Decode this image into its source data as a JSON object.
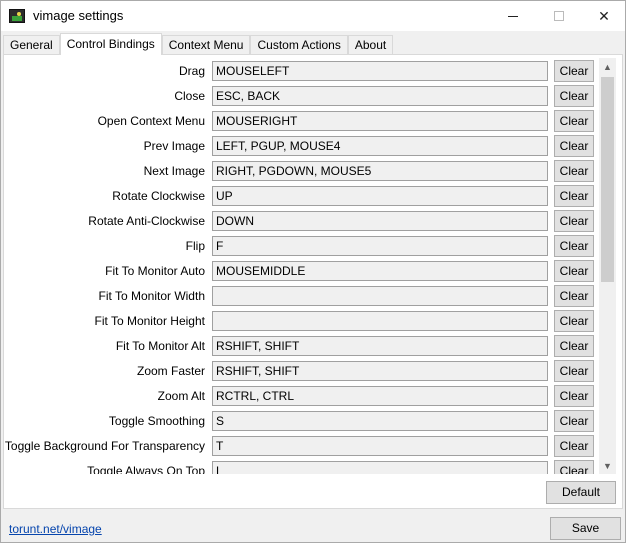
{
  "window": {
    "title": "vimage settings",
    "icon": "vimage-app-icon",
    "controls": {
      "minimize": "minimize-icon",
      "maximize": "maximize-icon",
      "close": "✕"
    }
  },
  "tabs": [
    {
      "label": "General",
      "active": false
    },
    {
      "label": "Control Bindings",
      "active": true
    },
    {
      "label": "Context Menu",
      "active": false
    },
    {
      "label": "Custom Actions",
      "active": false
    },
    {
      "label": "About",
      "active": false
    }
  ],
  "bindings": [
    {
      "label": "Drag",
      "value": "MOUSELEFT",
      "clear": "Clear"
    },
    {
      "label": "Close",
      "value": "ESC, BACK",
      "clear": "Clear"
    },
    {
      "label": "Open Context Menu",
      "value": "MOUSERIGHT",
      "clear": "Clear"
    },
    {
      "label": "Prev Image",
      "value": "LEFT, PGUP, MOUSE4",
      "clear": "Clear"
    },
    {
      "label": "Next Image",
      "value": "RIGHT, PGDOWN, MOUSE5",
      "clear": "Clear"
    },
    {
      "label": "Rotate Clockwise",
      "value": "UP",
      "clear": "Clear"
    },
    {
      "label": "Rotate Anti-Clockwise",
      "value": "DOWN",
      "clear": "Clear"
    },
    {
      "label": "Flip",
      "value": "F",
      "clear": "Clear"
    },
    {
      "label": "Fit To Monitor Auto",
      "value": "MOUSEMIDDLE",
      "clear": "Clear"
    },
    {
      "label": "Fit To Monitor Width",
      "value": "",
      "clear": "Clear"
    },
    {
      "label": "Fit To Monitor Height",
      "value": "",
      "clear": "Clear"
    },
    {
      "label": "Fit To Monitor Alt",
      "value": "RSHIFT, SHIFT",
      "clear": "Clear"
    },
    {
      "label": "Zoom Faster",
      "value": "RSHIFT, SHIFT",
      "clear": "Clear"
    },
    {
      "label": "Zoom Alt",
      "value": "RCTRL, CTRL",
      "clear": "Clear"
    },
    {
      "label": "Toggle Smoothing",
      "value": "S",
      "clear": "Clear"
    },
    {
      "label": "Toggle Background For Transparency",
      "value": "T",
      "clear": "Clear"
    },
    {
      "label": "Toggle Always On Top",
      "value": "L",
      "clear": "Clear"
    }
  ],
  "buttons": {
    "default": "Default",
    "save": "Save"
  },
  "footer": {
    "link": "torunt.net/vimage"
  },
  "scrollbar": {
    "up": "▲",
    "down": "▼"
  }
}
